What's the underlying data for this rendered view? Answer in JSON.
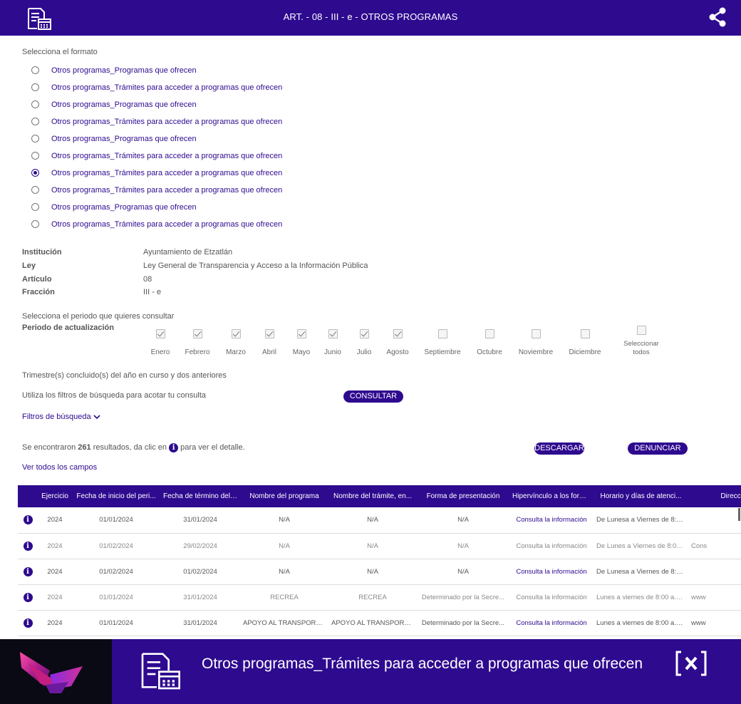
{
  "header": {
    "title": "ART. - 08 - III - e - OTROS PROGRAMAS"
  },
  "format": {
    "label": "Selecciona el formato",
    "options": [
      "Otros programas_Programas que ofrecen",
      "Otros programas_Trámites para acceder a programas que ofrecen",
      "Otros programas_Programas que ofrecen",
      "Otros programas_Trámites para acceder a programas que ofrecen",
      "Otros programas_Programas que ofrecen",
      "Otros programas_Trámites para acceder a programas que ofrecen",
      "Otros programas_Trámites para acceder a programas que ofrecen",
      "Otros programas_Trámites para acceder a programas que ofrecen",
      "Otros programas_Programas que ofrecen",
      "Otros programas_Trámites para acceder a programas que ofrecen"
    ],
    "selected_index": 6
  },
  "info": {
    "institucion_label": "Institución",
    "institucion": "Ayuntamiento de Etzatlán",
    "ley_label": "Ley",
    "ley": "Ley General de Transparencia y Acceso a la Información Pública",
    "articulo_label": "Artículo",
    "articulo": "08",
    "fraccion_label": "Fracción",
    "fraccion": "III - e"
  },
  "periodo": {
    "prompt": "Selecciona el periodo que quieres consultar",
    "label": "Periodo de actualización",
    "months": [
      {
        "name": "Enero",
        "checked": true
      },
      {
        "name": "Febrero",
        "checked": true
      },
      {
        "name": "Marzo",
        "checked": true
      },
      {
        "name": "Abril",
        "checked": true
      },
      {
        "name": "Mayo",
        "checked": true
      },
      {
        "name": "Junio",
        "checked": true
      },
      {
        "name": "Julio",
        "checked": true
      },
      {
        "name": "Agosto",
        "checked": true
      },
      {
        "name": "Septiembre",
        "checked": false
      },
      {
        "name": "Octubre",
        "checked": false
      },
      {
        "name": "Noviembre",
        "checked": false
      },
      {
        "name": "Diciembre",
        "checked": false
      }
    ],
    "select_all": "Seleccionar todos",
    "note": "Trimestre(s) concluido(s) del año en curso y dos anteriores"
  },
  "filters": {
    "hint": "Utiliza los filtros de búsqueda para acotar tu consulta",
    "consultar": "CONSULTAR",
    "toggle": "Filtros de búsqueda"
  },
  "results": {
    "prefix": "Se encontraron",
    "count": "261",
    "suffix_a": "resultados, da clic en",
    "suffix_b": "para ver el detalle.",
    "descargar": "DESCARGAR",
    "denunciar": "DENUNCIAR",
    "ver_todos": "Ver todos los campos"
  },
  "table": {
    "columns": [
      "",
      "Ejercicio",
      "Fecha de inicio del peri...",
      "Fecha de término del p...",
      "Nombre del programa",
      "Nombre del trámite, en...",
      "Forma de presentación",
      "Hipervínculo a los form...",
      "Horario y días de atenci...",
      "Direcc"
    ],
    "rows": [
      [
        "2024",
        "01/01/2024",
        "31/01/2024",
        "N/A",
        "N/A",
        "N/A",
        "Consulta la información",
        "De Lunesa a Viernes de 8:00...",
        ""
      ],
      [
        "2024",
        "01/02/2024",
        "29/02/2024",
        "N/A",
        "N/A",
        "N/A",
        "Consulta la información",
        "De Lunes a Viernes de 8:00 ...",
        "Cons"
      ],
      [
        "2024",
        "01/02/2024",
        "01/02/2024",
        "N/A",
        "N/A",
        "N/A",
        "Consulta la información",
        "De Lunesa a Viernes de 8:00...",
        ""
      ],
      [
        "2024",
        "01/01/2024",
        "31/01/2024",
        "RECREA",
        "RECREA",
        "Determinado por la Secre...",
        "Consulta la información",
        "Lunes a viernes de 8:00 a.m...",
        "www"
      ],
      [
        "2024",
        "01/01/2024",
        "31/01/2024",
        "APOYO AL TRANSPORTE ...",
        "APOYO AL TRANSPORTE PA...",
        "Determinado por la Secre...",
        "Consulta la información",
        "Lunes a viernes de 8:00 a.m...",
        "www"
      ]
    ],
    "faded_rows": [
      1,
      3
    ]
  },
  "banner": {
    "title": "Otros programas_Trámites para acceder a programas que ofrecen"
  },
  "colors": {
    "primary": "#2e0a8f"
  },
  "icons": [
    "document-calendar-icon",
    "share-icon",
    "info-icon",
    "chevron-down-icon",
    "close-icon"
  ]
}
